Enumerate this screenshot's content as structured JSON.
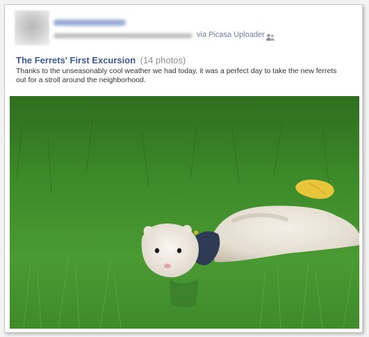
{
  "post": {
    "via_text": "via Picasa Uploader",
    "album": {
      "title": "The Ferrets' First Excursion",
      "count": "(14 photos)"
    },
    "description": "Thanks to the unseasonably cool weather we had today, it was a perfect day to take the new ferrets out for a stroll around the neighborhood."
  },
  "icons": {
    "audience": "people-icon"
  },
  "colors": {
    "link": "#3b5998",
    "muted": "#8e8e8e",
    "grass": "#3f8a2c"
  }
}
